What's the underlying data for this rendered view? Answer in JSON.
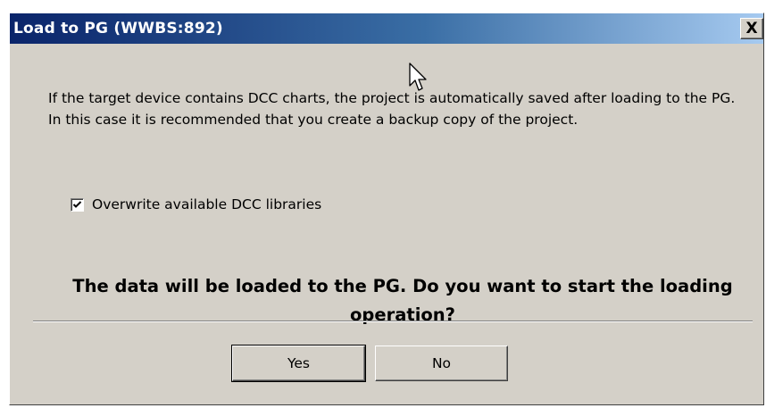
{
  "window": {
    "title": "Load to PG (WWBS:892)",
    "close_label": "X"
  },
  "message": "If the target device contains DCC charts, the project is automatically saved after loading to the PG. In this case it is recommended that you create a backup copy of the project.",
  "checkbox": {
    "label": "Overwrite available DCC libraries",
    "checked": true
  },
  "question": "The data will be loaded to the PG. Do you want to start the loading operation?",
  "buttons": {
    "yes": "Yes",
    "no": "No"
  },
  "colors": {
    "face": "#d4d0c8",
    "title_start": "#0a246a",
    "title_end": "#a6caf0"
  }
}
